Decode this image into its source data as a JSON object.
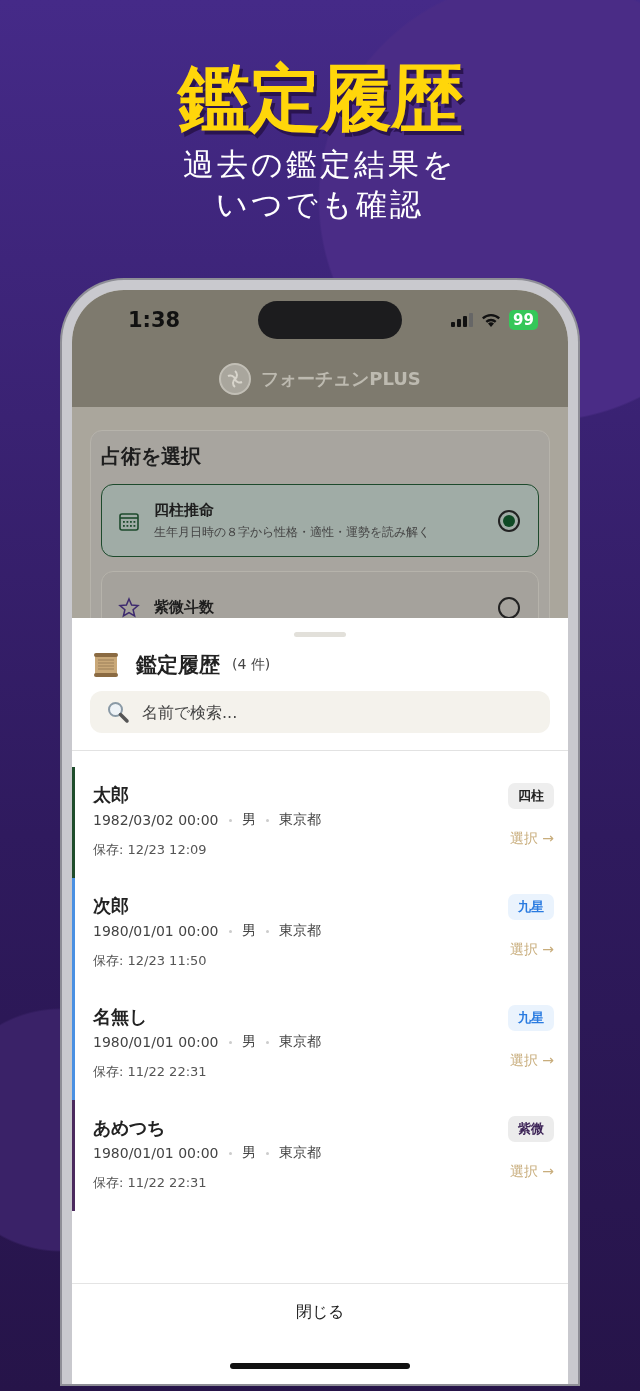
{
  "headline": {
    "title": "鑑定履歴",
    "subtitle_lines": [
      "過去の鑑定結果を",
      "いつでも確認"
    ]
  },
  "status_bar": {
    "time": "1:38",
    "battery": "99"
  },
  "app_header": {
    "title": "フォーチュンPLUS"
  },
  "background_screen": {
    "title": "占術を選択",
    "options": [
      {
        "kind": "calendar",
        "name": "四柱推命",
        "description": "生年月日時の８字から性格・適性・運勢を読み解く",
        "selected": true
      },
      {
        "kind": "star",
        "name": "紫微斗数",
        "selected": false
      }
    ]
  },
  "sheet": {
    "title": "鑑定履歴",
    "count": "(4 件)",
    "search": {
      "placeholder": "名前で検索..."
    },
    "records": [
      {
        "name": "太郎",
        "birth": "1982/03/02 00:00",
        "gender": "男",
        "place": "東京都",
        "saved": "保存: 12/23 12:09",
        "tag": "四柱",
        "kind": "shichu",
        "color": "#1f4d2c",
        "action": "選択 →"
      },
      {
        "name": "次郎",
        "birth": "1980/01/01 00:00",
        "gender": "男",
        "place": "東京都",
        "saved": "保存: 12/23 11:50",
        "tag": "九星",
        "kind": "kyusei",
        "color": "#4a90e2",
        "action": "選択 →"
      },
      {
        "name": "名無し",
        "birth": "1980/01/01 00:00",
        "gender": "男",
        "place": "東京都",
        "saved": "保存: 11/22 22:31",
        "tag": "九星",
        "kind": "kyusei",
        "color": "#4a90e2",
        "action": "選択 →"
      },
      {
        "name": "あめつち",
        "birth": "1980/01/01 00:00",
        "gender": "男",
        "place": "東京都",
        "saved": "保存: 11/22 22:31",
        "tag": "紫微",
        "kind": "shibi",
        "color": "#4b2a5e",
        "action": "選択 →"
      }
    ],
    "close_button": "閉じる"
  }
}
